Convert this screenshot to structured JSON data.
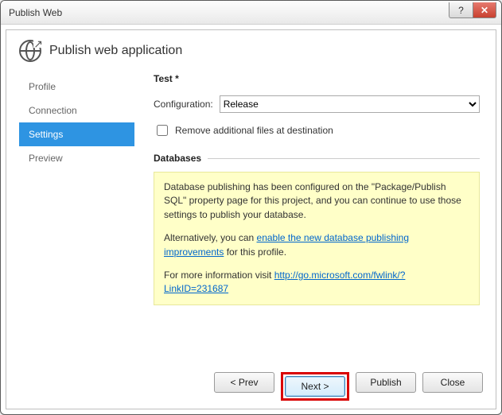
{
  "window": {
    "title": "Publish Web"
  },
  "header": {
    "title": "Publish web application"
  },
  "sidebar": {
    "items": [
      {
        "label": "Profile"
      },
      {
        "label": "Connection"
      },
      {
        "label": "Settings"
      },
      {
        "label": "Preview"
      }
    ]
  },
  "main": {
    "profileTitle": "Test *",
    "configLabel": "Configuration:",
    "configValue": "Release",
    "removeFilesLabel": "Remove additional files at destination",
    "removeFilesChecked": false,
    "databasesLabel": "Databases",
    "dbInfo": {
      "p1": "Database publishing has been configured on the \"Package/Publish SQL\" property page for this project, and you can continue to use those settings to publish your database.",
      "p2a": "Alternatively, you can ",
      "p2link": "enable the new database publishing improvements",
      "p2b": " for this profile.",
      "p3a": "For more information visit ",
      "p3link": "http://go.microsoft.com/fwlink/?LinkID=231687"
    }
  },
  "footer": {
    "prev": "< Prev",
    "next": "Next >",
    "publish": "Publish",
    "close": "Close"
  }
}
